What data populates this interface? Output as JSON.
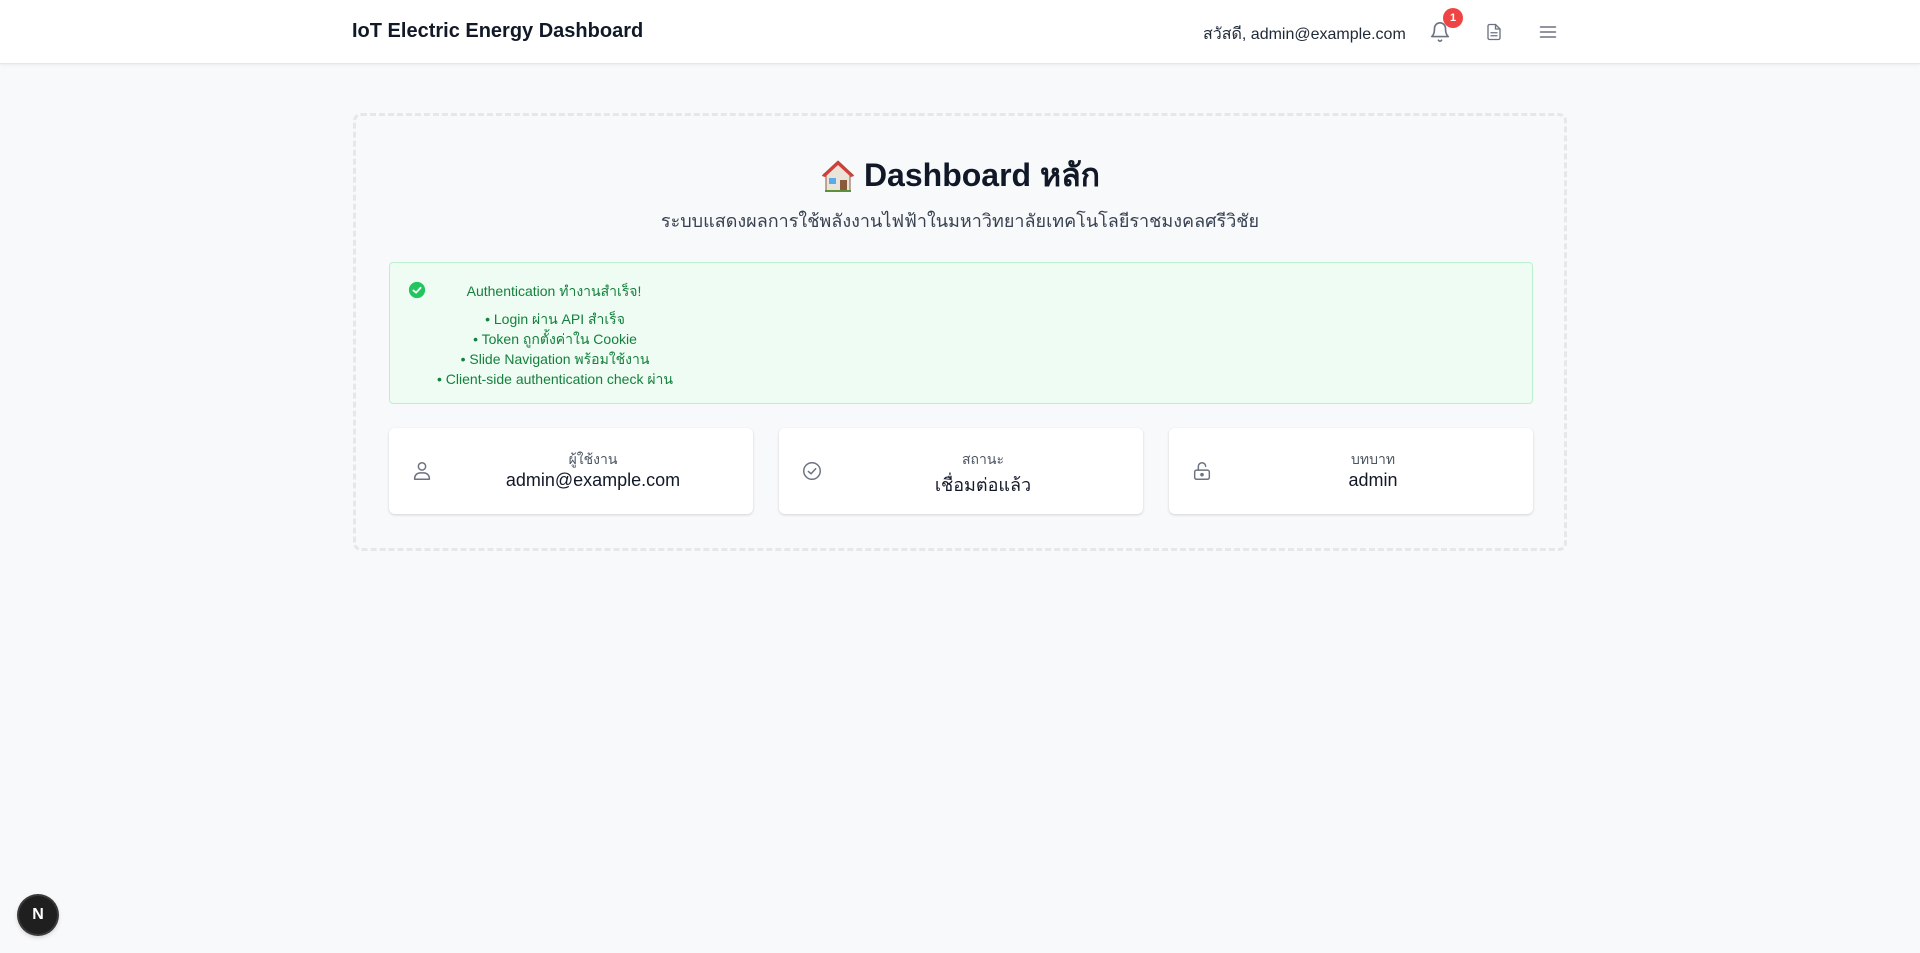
{
  "navbar": {
    "brand": "IoT Electric Energy Dashboard",
    "greeting": "สวัสดี, admin@example.com",
    "notification_count": "1"
  },
  "main": {
    "title": "Dashboard หลัก",
    "subtitle": "ระบบแสดงผลการใช้พลังงานไฟฟ้าในมหาวิทยาลัยเทคโนโลยีราชมงคลศรีวิชัย"
  },
  "alert": {
    "heading": "Authentication ทำงานสำเร็จ!",
    "items": [
      "• Login ผ่าน API สำเร็จ",
      "• Token ถูกตั้งค่าใน Cookie",
      "• Slide Navigation พร้อมใช้งาน",
      "• Client-side authentication check ผ่าน"
    ]
  },
  "cards": [
    {
      "label": "ผู้ใช้งาน",
      "value": "admin@example.com",
      "icon": "user-icon"
    },
    {
      "label": "สถานะ",
      "value": "เชื่อมต่อแล้ว",
      "icon": "check-circle-icon"
    },
    {
      "label": "บทบาท",
      "value": "admin",
      "icon": "lock-icon"
    }
  ],
  "dev_badge": {
    "label": "N"
  },
  "colors": {
    "accent_green": "#15803d",
    "alert_bg": "#effcf3",
    "badge_red": "#ef4444",
    "page_bg": "#f8f9fb"
  }
}
